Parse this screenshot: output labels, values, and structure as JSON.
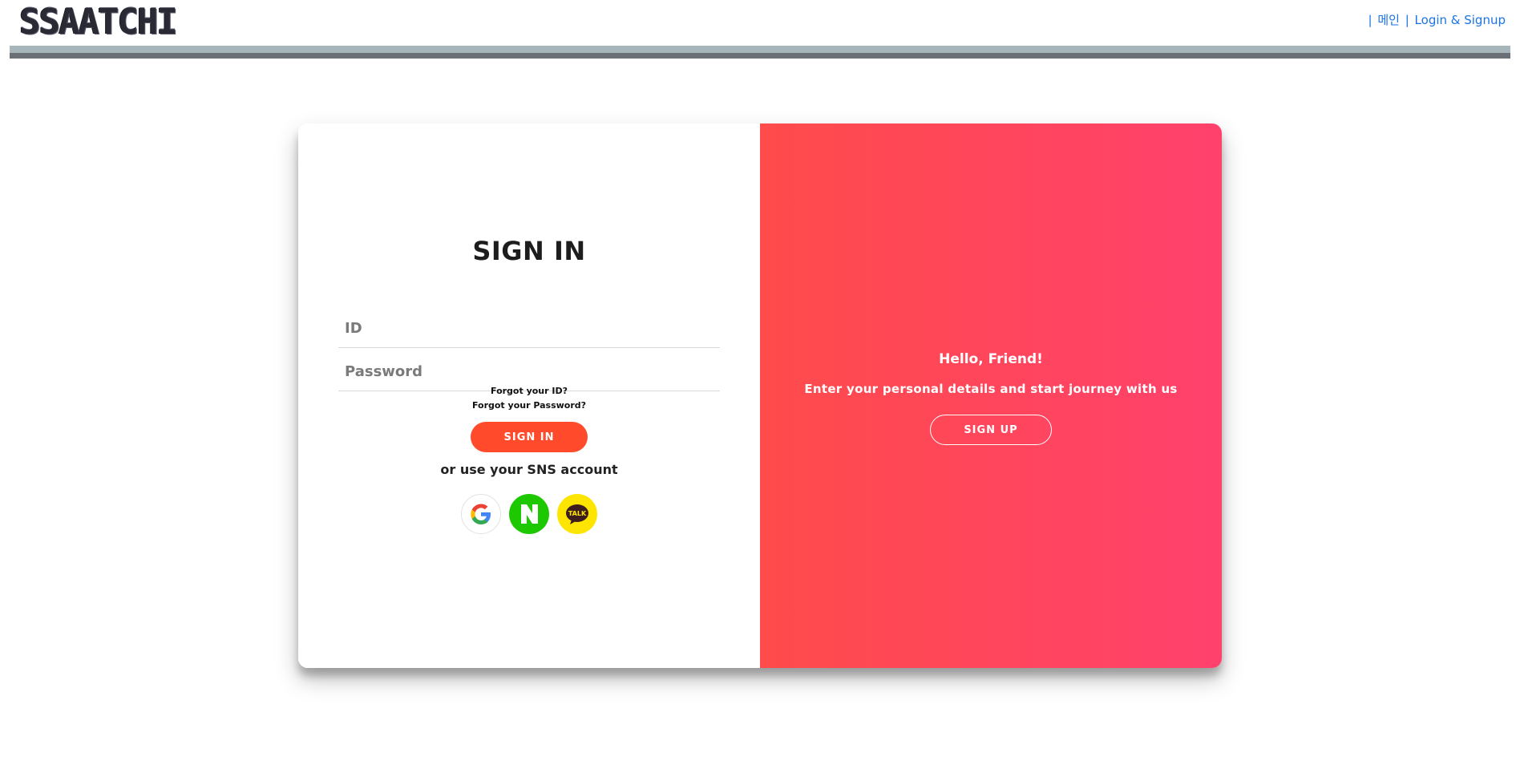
{
  "header": {
    "logo": "SSAATCHI",
    "nav": {
      "sep_left": "|",
      "main_link": "메인",
      "sep_mid": "|",
      "login_link": "Login & Signup"
    }
  },
  "signin": {
    "title": "SIGN IN",
    "id_placeholder": "ID",
    "password_placeholder": "Password",
    "forgot_id": "Forgot your ID?",
    "forgot_password": "Forgot your Password?",
    "button_label": "SIGN IN",
    "sns_label": "or use your SNS account",
    "sns": [
      {
        "name": "google",
        "icon": "google-icon"
      },
      {
        "name": "naver",
        "icon": "naver-icon",
        "glyph": "N"
      },
      {
        "name": "kakao",
        "icon": "kakao-talk-icon",
        "glyph": "TALK"
      }
    ]
  },
  "overlay": {
    "title": "Hello, Friend!",
    "subtitle": "Enter your personal details and start journey with us",
    "button_label": "SIGN UP"
  },
  "colors": {
    "accent": "#ff4b2b",
    "gradient_start": "#ff4b4b",
    "gradient_end": "#ff416c",
    "link": "#1a73e8",
    "naver": "#1ec800",
    "kakao": "#fee500"
  }
}
